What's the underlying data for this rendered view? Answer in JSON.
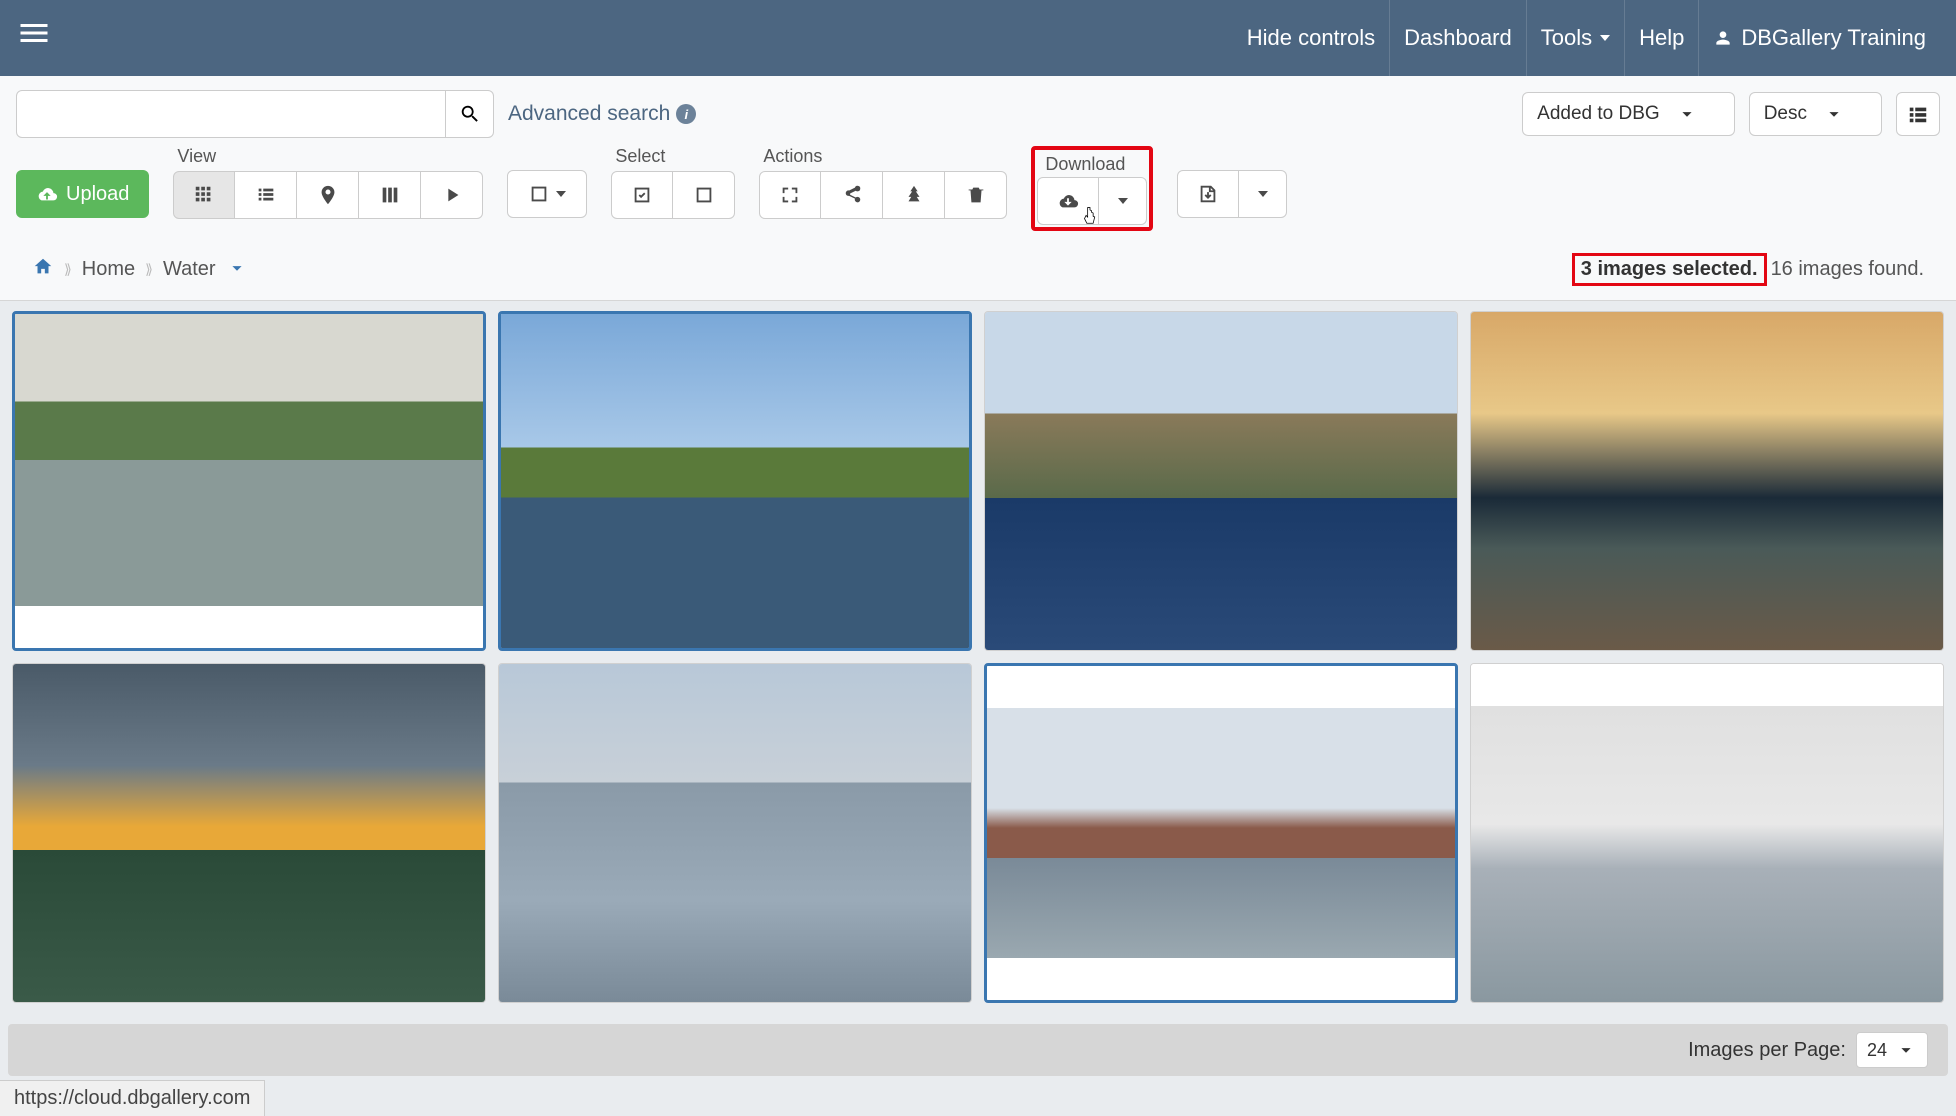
{
  "nav": {
    "hide_controls": "Hide controls",
    "dashboard": "Dashboard",
    "tools": "Tools",
    "help": "Help",
    "user": "DBGallery Training"
  },
  "search": {
    "placeholder": "",
    "advanced": "Advanced search"
  },
  "sort": {
    "field": "Added to DBG",
    "order": "Desc"
  },
  "toolbar": {
    "upload": "Upload",
    "view_label": "View",
    "select_label": "Select",
    "actions_label": "Actions",
    "download_label": "Download"
  },
  "breadcrumb": {
    "home": "Home",
    "current": "Water"
  },
  "status": {
    "selected": "3 images selected.",
    "found": "16 images found."
  },
  "footer": {
    "label": "Images per Page:",
    "value": "24"
  },
  "status_url": "https://cloud.dbgallery.com"
}
